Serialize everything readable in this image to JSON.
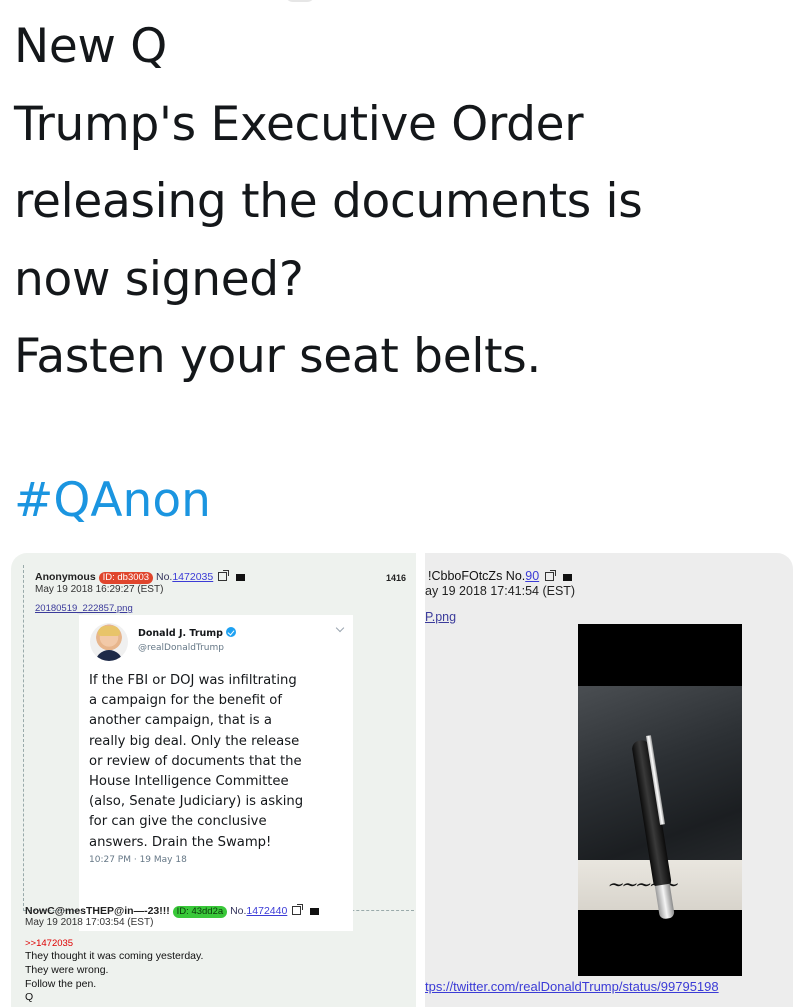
{
  "tweet": {
    "lines": [
      "New Q",
      "Trump's Executive Order",
      "releasing the documents is",
      "now signed?",
      "Fasten your seat belts."
    ],
    "hashtag": "#QAnon"
  },
  "left_image": {
    "post1": {
      "name": "Anonymous",
      "id": "ID: db3003",
      "number_prefix": "No.",
      "number": "1472035",
      "date": "May 19 2018 16:29:27 (EST)",
      "filename": "20180519_222857.png",
      "count": "1416"
    },
    "embedded_tweet": {
      "name": "Donald J. Trump",
      "handle": "@realDonaldTrump",
      "body_lines": [
        "If the FBI or DOJ was infiltrating",
        "a campaign for the benefit of",
        "another campaign, that is a",
        "really big deal. Only the release",
        "or review of documents that the",
        "House Intelligence Committee",
        "(also, Senate Judiciary) is asking",
        "for can give the conclusive",
        "answers. Drain the Swamp!"
      ],
      "time": "10:27 PM · 19 May 18"
    },
    "post2": {
      "name": "NowC@mesTHEP@in—-23!!!",
      "id": "ID: 43dd2a",
      "number_prefix": "No.",
      "number": "1472440",
      "date": "May 19 2018 17:03:54 (EST)",
      "reply_to": ">>1472035",
      "body_lines": [
        "They thought it was coming yesterday.",
        "They were wrong.",
        "Follow the pen.",
        "Q"
      ]
    }
  },
  "right_image": {
    "head_text": "!CbboFOtcZs No.",
    "number": "90",
    "date": "ay 19 2018 17:41:54 (EST)",
    "filename": "P.png",
    "url": "tps://twitter.com/realDonaldTrump/status/99795198"
  },
  "colors": {
    "hashtag": "#1b95e0",
    "id_red": "#e0452c",
    "id_green": "#39c839",
    "link": "#3b3bd6",
    "reply_link": "#dd0000"
  }
}
